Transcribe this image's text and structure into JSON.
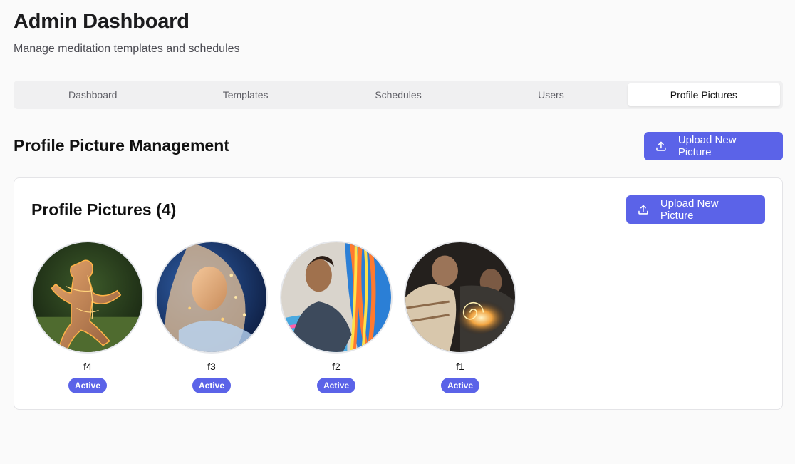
{
  "header": {
    "title": "Admin Dashboard",
    "subtitle": "Manage meditation templates and schedules"
  },
  "tabs": [
    {
      "label": "Dashboard",
      "active": false
    },
    {
      "label": "Templates",
      "active": false
    },
    {
      "label": "Schedules",
      "active": false
    },
    {
      "label": "Users",
      "active": false
    },
    {
      "label": "Profile Pictures",
      "active": true
    }
  ],
  "section": {
    "title": "Profile Picture Management",
    "upload_label": "Upload New Picture",
    "upload_icon": "upload-icon"
  },
  "card": {
    "title": "Profile Pictures (4)",
    "upload_label": "Upload New Picture"
  },
  "pictures": [
    {
      "name": "f4",
      "status": "Active"
    },
    {
      "name": "f3",
      "status": "Active"
    },
    {
      "name": "f2",
      "status": "Active"
    },
    {
      "name": "f1",
      "status": "Active"
    }
  ],
  "colors": {
    "accent": "#5b63e8",
    "background": "#fafafa",
    "card_border": "#e4e4e7",
    "tab_bar": "#f0f0f1"
  }
}
